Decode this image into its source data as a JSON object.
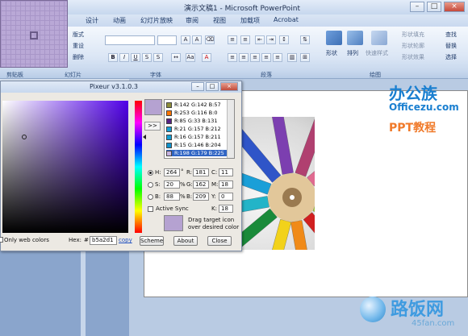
{
  "window": {
    "title": "演示文稿1 - Microsoft PowerPoint"
  },
  "tabs": [
    "设计",
    "动画",
    "幻灯片放映",
    "审阅",
    "视图",
    "加载项",
    "Acrobat"
  ],
  "ribbon": {
    "slides_group": {
      "layout": "版式",
      "reset": "重设",
      "delete": "删除"
    },
    "drawing_group": {
      "shape": "形状",
      "arrange": "排列",
      "quick_styles": "快速样式",
      "fill": "形状填充",
      "outline": "形状轮廓",
      "effects": "形状效果"
    },
    "editing_group": {
      "find": "查找",
      "replace": "替换",
      "select": "选择"
    },
    "group_labels": [
      "剪贴板",
      "幻灯片",
      "字体",
      "段落",
      "绘图"
    ]
  },
  "pixeur": {
    "title": "Pixeur v3.1.0.3",
    "arrow_label": ">>",
    "history": [
      {
        "label": "R:142 G:142 B:57",
        "color": "#8e8e39"
      },
      {
        "label": "R:253 G:116 B:0",
        "color": "#fd7400"
      },
      {
        "label": "R:85 G:33 B:131",
        "color": "#552183"
      },
      {
        "label": "R:21 G:157 B:212",
        "color": "#159dd4"
      },
      {
        "label": "R:16 G:157 B:211",
        "color": "#109dd3"
      },
      {
        "label": "R:15 G:146 B:204",
        "color": "#0f92cc"
      },
      {
        "label": "R:198 G:179 B:225",
        "color": "#c6b3e1"
      }
    ],
    "hsb": {
      "h_label": "H:",
      "h": "264",
      "s_label": "S:",
      "s": "20",
      "b_label": "B:",
      "b": "88",
      "deg": "°",
      "pct": "%"
    },
    "rgb": {
      "r_label": "R:",
      "r": "181",
      "g_label": "G:",
      "g": "162",
      "b_label": "B:",
      "b": "209"
    },
    "cmyk": {
      "c_label": "C:",
      "c": "11",
      "m_label": "M:",
      "m": "18",
      "y_label": "Y:",
      "y": "0",
      "k_label": "K:",
      "k": "18"
    },
    "active_sync": "Active Sync",
    "drag_hint": "Drag target icon over desired color",
    "web_colors": "Only web colors",
    "hex_label": "Hex:",
    "hex_hash": "#",
    "hex_value": "b5a2d1",
    "copy": "copy",
    "buttons": {
      "scheme": "Scheme",
      "about": "About",
      "close": "Close"
    },
    "current_color": "#b5a2d1"
  },
  "logo": {
    "line1": "办公族",
    "line2": "Officezu.com",
    "line3": "PPT教程"
  },
  "watermark": {
    "name": "路饭网",
    "url": "45fan.com"
  }
}
